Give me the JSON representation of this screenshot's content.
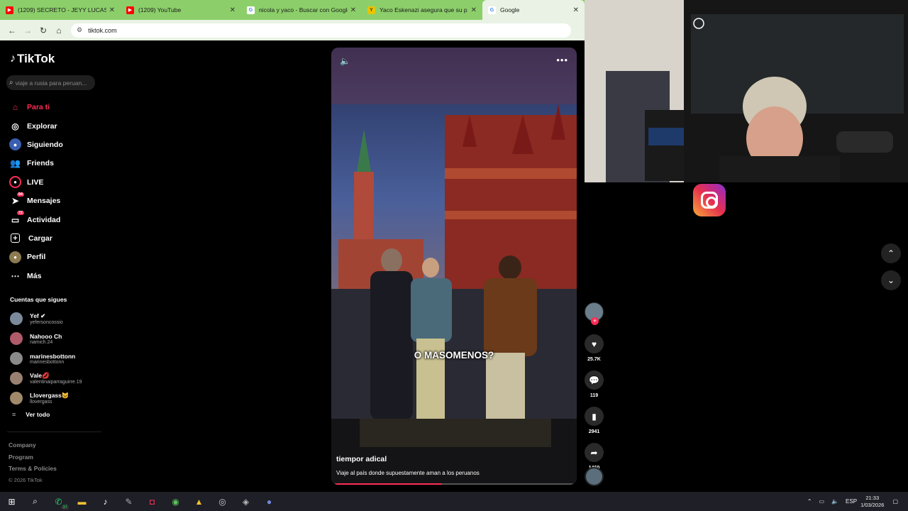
{
  "browser": {
    "tabs": [
      {
        "title": "(1209) SECRETO - JEYY LUCAS 🎙",
        "icon": "youtube-icon",
        "color": "#ff0000"
      },
      {
        "title": "(1209) YouTube",
        "icon": "youtube-icon",
        "color": "#ff0000"
      },
      {
        "title": "nicola y yaco - Buscar con Google",
        "icon": "google-icon",
        "color": "#4285f4"
      },
      {
        "title": "Yaco Eskenazi asegura que su p",
        "icon": "article-icon",
        "color": "#e8c500"
      },
      {
        "title": "Google",
        "icon": "google-icon",
        "color": "#4285f4"
      }
    ],
    "url": "tiktok.com"
  },
  "sidebar": {
    "logo": "TikTok",
    "search_placeholder": "viaje a rusia para peruan...",
    "nav": [
      {
        "label": "Para ti",
        "icon": "home-icon",
        "active": true
      },
      {
        "label": "Explorar",
        "icon": "compass-icon"
      },
      {
        "label": "Siguiendo",
        "icon": "following-icon"
      },
      {
        "label": "Friends",
        "icon": "friends-icon"
      },
      {
        "label": "LIVE",
        "icon": "live-icon"
      },
      {
        "label": "Mensajes",
        "icon": "messages-icon",
        "badge": "94"
      },
      {
        "label": "Actividad",
        "icon": "activity-icon",
        "badge": "72"
      },
      {
        "label": "Cargar",
        "icon": "upload-icon"
      },
      {
        "label": "Perfil",
        "icon": "profile-icon"
      },
      {
        "label": "Más",
        "icon": "more-icon"
      }
    ],
    "following_title": "Cuentas que sigues",
    "following": [
      {
        "name": "Yef ✔",
        "user": "yefersoncossio"
      },
      {
        "name": "Nahooo Ch",
        "user": "namich.24"
      },
      {
        "name": "marinesbottonn",
        "user": "marinesbottonn"
      },
      {
        "name": "Vale💋",
        "user": "valentinaiparraguirre.19"
      },
      {
        "name": "Llovergass😺",
        "user": "llovergass"
      }
    ],
    "see_all": "Ver todo",
    "footer": {
      "company": "Company",
      "program": "Program",
      "terms": "Terms & Policies",
      "copyright": "© 2026 TikTok"
    }
  },
  "video": {
    "caption": "O MASOMENOS?",
    "author": "tiempor adical",
    "description": "Viaje al país donde supuestamente aman a los peruanos",
    "progress": 0.45
  },
  "actions": {
    "likes": "25.7K",
    "comments": "119",
    "saves": "2941",
    "shares": "1460"
  },
  "taskbar": {
    "whatsapp_badge": "37",
    "lang": "ESP",
    "time": "21:33",
    "date": "1/03/2026"
  }
}
